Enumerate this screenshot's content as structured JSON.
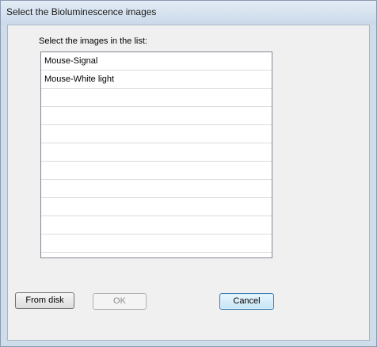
{
  "window": {
    "title": "Select the Bioluminescence images"
  },
  "dialog": {
    "list_label": "Select the images in the list:",
    "list_items": [
      "Mouse-Signal",
      "Mouse-White light",
      "",
      "",
      "",
      "",
      "",
      "",
      "",
      "",
      "",
      ""
    ]
  },
  "buttons": {
    "from_disk": "From disk",
    "ok": "OK",
    "cancel": "Cancel"
  },
  "colors": {
    "window_frame": "#cfdcea",
    "client_bg": "#f0f0f0",
    "list_bg": "#ffffff",
    "default_button_border": "#3c7fb1"
  }
}
